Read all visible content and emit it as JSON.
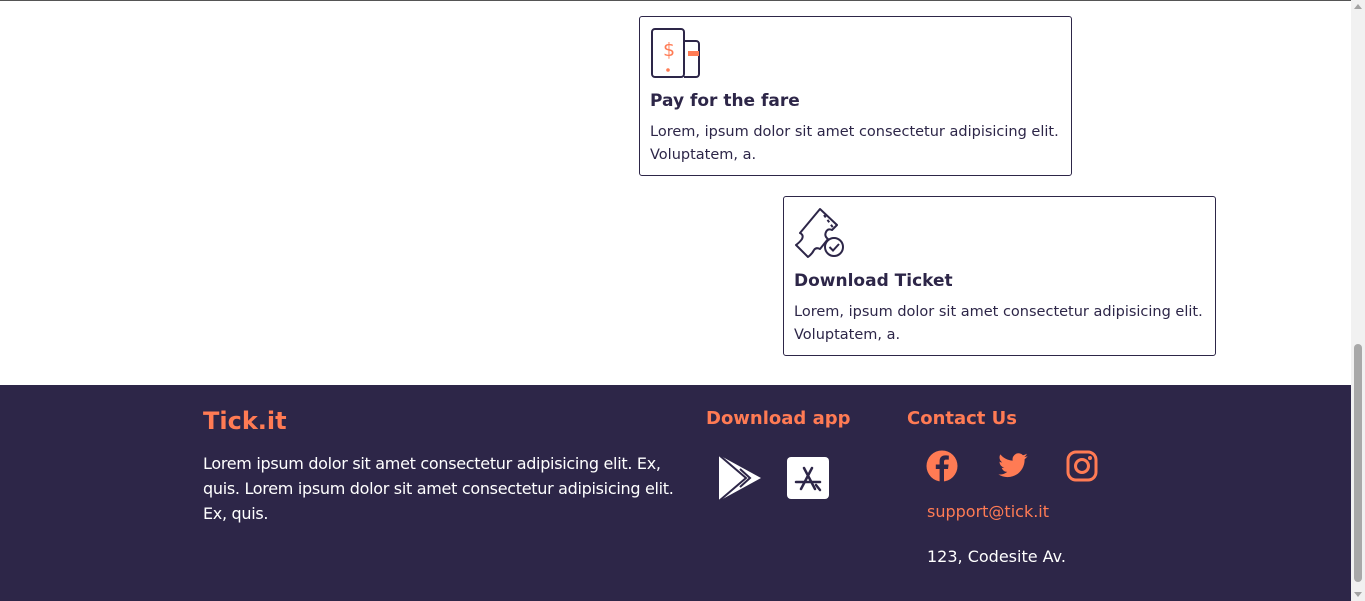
{
  "cards": [
    {
      "title": "Pay for the fare",
      "description": "Lorem, ipsum dolor sit amet consectetur adipisicing elit. Voluptatem, a.",
      "icon": "phone-payment-icon"
    },
    {
      "title": "Download Ticket",
      "description": "Lorem, ipsum dolor sit amet consectetur adipisicing elit. Voluptatem, a.",
      "icon": "ticket-check-icon"
    }
  ],
  "footer": {
    "brand": "Tick.it",
    "about": "Lorem ipsum dolor sit amet consectetur adipisicing elit. Ex, quis. Lorem ipsum dolor sit amet consectetur adipisicing elit. Ex, quis.",
    "download_title": "Download app",
    "stores": [
      "google-play-icon",
      "app-store-icon"
    ],
    "contact_title": "Contact Us",
    "socials": [
      "facebook-icon",
      "twitter-icon",
      "instagram-icon"
    ],
    "email": "support@tick.it",
    "address": "123, Codesite Av."
  },
  "colors": {
    "accent": "#ff7b54",
    "dark": "#2d2648",
    "white": "#ffffff"
  }
}
